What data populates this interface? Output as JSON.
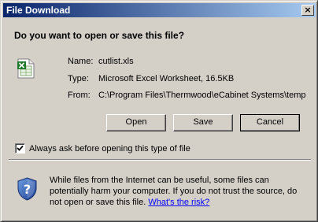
{
  "window": {
    "title": "File Download",
    "close_label": "×"
  },
  "prompt": {
    "question": "Do you want to open or save this file?"
  },
  "file": {
    "icon": "excel-file-icon",
    "name_label": "Name:",
    "name_value": "cutlist.xls",
    "type_label": "Type:",
    "type_value": "Microsoft Excel Worksheet, 16.5KB",
    "from_label": "From:",
    "from_value": "C:\\Program Files\\Thermwood\\eCabinet Systems\\temp"
  },
  "buttons": {
    "open": "Open",
    "save": "Save",
    "cancel": "Cancel"
  },
  "option": {
    "checked": true,
    "label": "Always ask before opening this type of file"
  },
  "warning": {
    "icon": "security-shield-icon",
    "text": "While files from the Internet can be useful, some files can potentially harm your computer. If you do not trust the source, do not open or save this file.",
    "link": "What's the risk?"
  },
  "colors": {
    "face": "#d4d0c8",
    "title_start": "#0a246a",
    "title_end": "#a6caf0",
    "link": "#0000ff"
  }
}
